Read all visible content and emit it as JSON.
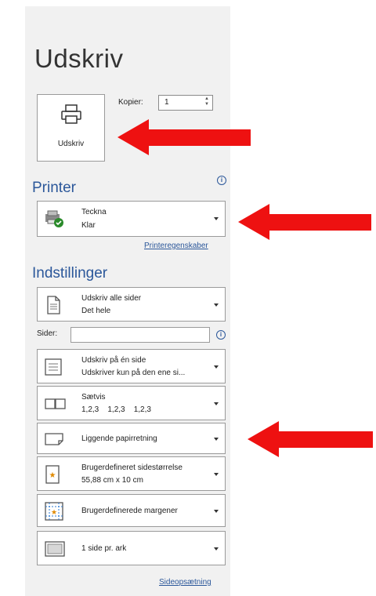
{
  "title": "Udskriv",
  "print_button": {
    "label": "Udskriv",
    "icon": "printer-icon"
  },
  "copies": {
    "label": "Kopier:",
    "value": "1"
  },
  "printer": {
    "heading": "Printer",
    "name": "Teckna",
    "status": "Klar",
    "properties_link": "Printeregenskaber"
  },
  "settings": {
    "heading": "Indstillinger",
    "pages_label": "Sider:",
    "items": [
      {
        "l1": "Udskriv alle sider",
        "l2": "Det hele",
        "icon": "page-icon"
      },
      {
        "l1": "Udskriv på én side",
        "l2": "Udskriver kun på den ene si...",
        "icon": "one-sided-icon"
      },
      {
        "l1": "Sætvis",
        "l2": "1,2,3    1,2,3    1,2,3",
        "icon": "collate-icon"
      },
      {
        "l1": "Liggende papirretning",
        "l2": "",
        "icon": "landscape-icon"
      },
      {
        "l1": "Brugerdefineret sidestørrelse",
        "l2": "55,88 cm x 10 cm",
        "icon": "page-size-icon"
      },
      {
        "l1": "Brugerdefinerede margener",
        "l2": "",
        "icon": "margins-icon"
      },
      {
        "l1": "1 side pr. ark",
        "l2": "",
        "icon": "pages-per-sheet-icon"
      }
    ],
    "page_setup_link": "Sideopsætning"
  },
  "colors": {
    "accent": "#2b579a",
    "arrow": "#ee1111",
    "panel": "#f1f1f1"
  }
}
